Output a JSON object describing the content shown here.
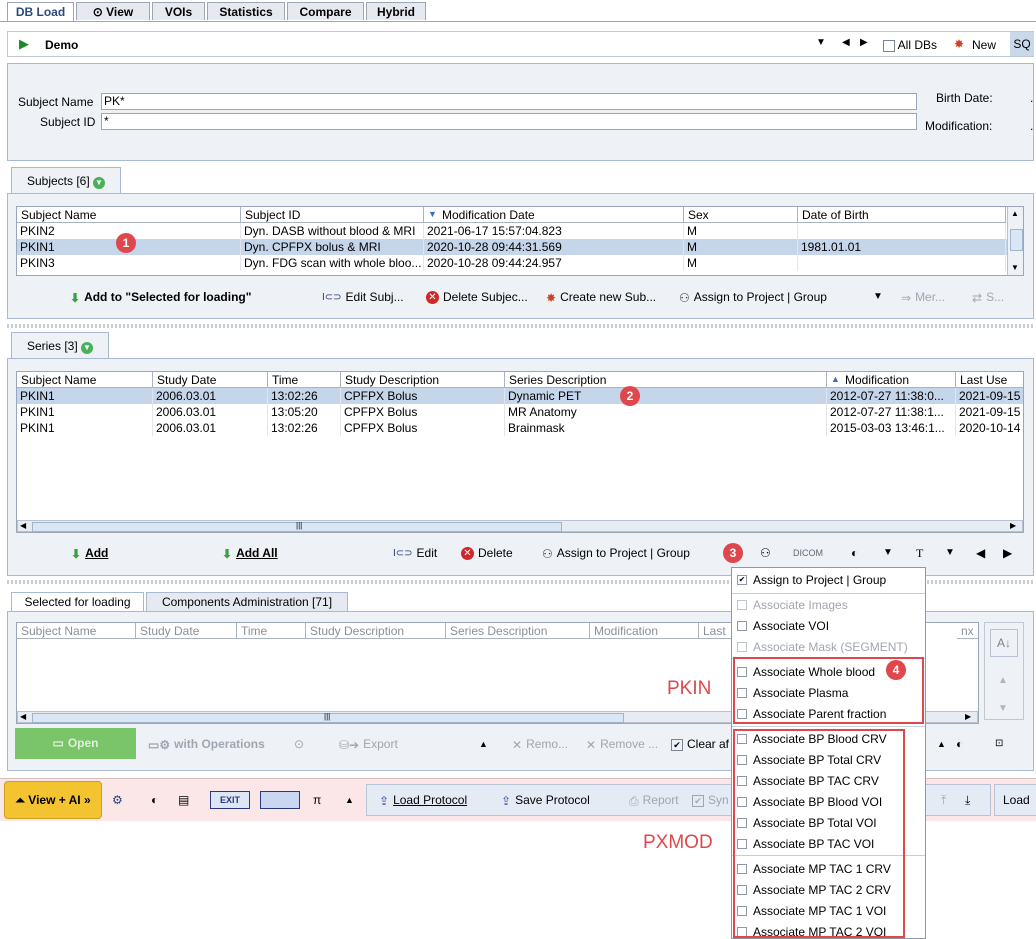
{
  "tabs": [
    {
      "label": "DB Load"
    },
    {
      "label": "View"
    },
    {
      "label": "VOIs"
    },
    {
      "label": "Statistics"
    },
    {
      "label": "Compare"
    },
    {
      "label": "Hybrid"
    }
  ],
  "toolbar": {
    "db_name": "Demo",
    "all_dbs": "All DBs",
    "new": "New",
    "sq": "SQ"
  },
  "search": {
    "subject_name_label": "Subject Name",
    "subject_name_value": "PK*",
    "subject_id_label": "Subject ID",
    "subject_id_value": "*",
    "birth_date_label": "Birth Date:",
    "modification_label": "Modification:",
    "birth_date_value": ".",
    "modification_value": "."
  },
  "subjects": {
    "tab_label": "Subjects [6]",
    "columns": [
      "Subject Name",
      "Subject ID",
      "Modification Date",
      "Sex",
      "Date of Birth"
    ],
    "rows": [
      [
        "PKIN2",
        "Dyn. DASB without blood & MRI",
        "2021-06-17 15:57:04.823",
        "M",
        ""
      ],
      [
        "PKIN1",
        "Dyn. CPFPX bolus & MRI",
        "2020-10-28 09:44:31.569",
        "M",
        "1981.01.01"
      ],
      [
        "PKIN3",
        "Dyn. FDG scan with whole bloo...",
        "2020-10-28 09:44:24.957",
        "M",
        ""
      ]
    ],
    "buttons": {
      "add": "Add to \"Selected for loading\"",
      "edit": "Edit Subj...",
      "delete": "Delete Subjec...",
      "create": "Create new Sub...",
      "assign": "Assign to Project | Group",
      "merge": "Mer...",
      "share": "S..."
    }
  },
  "series": {
    "tab_label": "Series [3]",
    "columns": [
      "Subject Name",
      "Study Date",
      "Time",
      "Study Description",
      "Series Description",
      "Modification",
      "Last Use"
    ],
    "rows": [
      [
        "PKIN1",
        "2006.03.01",
        "13:02:26",
        "CPFPX Bolus",
        "Dynamic PET",
        "2012-07-27 11:38:0...",
        "2021-09-15"
      ],
      [
        "PKIN1",
        "2006.03.01",
        "13:05:20",
        "CPFPX Bolus",
        "MR Anatomy",
        "2012-07-27 11:38:1...",
        "2021-09-15"
      ],
      [
        "PKIN1",
        "2006.03.01",
        "13:02:26",
        "CPFPX Bolus",
        "Brainmask",
        "2015-03-03 13:46:1...",
        "2020-10-14"
      ]
    ],
    "buttons": {
      "add": "Add",
      "add_all": "Add All",
      "edit": "Edit",
      "delete": "Delete",
      "assign": "Assign to Project | Group",
      "dicom": "DICOM"
    }
  },
  "selected": {
    "tab1": "Selected for loading",
    "tab2": "Components Administration [71]",
    "columns": [
      "Subject Name",
      "Study Date",
      "Time",
      "Study Description",
      "Series Description",
      "Modification",
      "Last",
      "nx"
    ],
    "buttons": {
      "open": "Open",
      "with_ops": "with Operations",
      "export": "Export",
      "remove": "Remo...",
      "remove_all": "Remove ...",
      "clear": "Clear af"
    }
  },
  "bottom": {
    "view_ai": "View + AI »",
    "exit": "EXIT",
    "load_protocol": "Load Protocol",
    "save_protocol": "Save Protocol",
    "report": "Report",
    "syn": "Syn",
    "load": "Load"
  },
  "menu": {
    "items": [
      {
        "label": "Assign to Project | Group",
        "checked": true,
        "enabled": true
      },
      {
        "label": "Associate Images",
        "enabled": false
      },
      {
        "label": "Associate VOI",
        "enabled": true
      },
      {
        "label": "Associate Mask (SEGMENT)",
        "enabled": false
      },
      {
        "label": "Associate Whole blood",
        "enabled": true
      },
      {
        "label": "Associate Plasma",
        "enabled": true
      },
      {
        "label": "Associate Parent fraction",
        "enabled": true
      },
      {
        "label": "Associate BP Blood CRV",
        "enabled": true
      },
      {
        "label": "Associate BP Total CRV",
        "enabled": true
      },
      {
        "label": "Associate BP TAC CRV",
        "enabled": true
      },
      {
        "label": "Associate BP Blood VOI",
        "enabled": true
      },
      {
        "label": "Associate BP Total VOI",
        "enabled": true
      },
      {
        "label": "Associate BP TAC VOI",
        "enabled": true
      },
      {
        "label": "Associate MP TAC 1 CRV",
        "enabled": true
      },
      {
        "label": "Associate MP TAC 2 CRV",
        "enabled": true
      },
      {
        "label": "Associate MP TAC 1 VOI",
        "enabled": true
      },
      {
        "label": "Associate MP TAC 2 VOI",
        "enabled": true
      }
    ]
  },
  "annotations": {
    "badge1": "1",
    "badge2": "2",
    "badge3": "3",
    "badge4": "4",
    "pkin": "PKIN",
    "pxmod": "PXMOD"
  },
  "colors": {
    "accent_red": "#e0474c",
    "selection": "#c5d5ea",
    "panel": "#eef1f6",
    "open_green": "#7ac46a",
    "view_ai_yellow": "#f4c430"
  }
}
